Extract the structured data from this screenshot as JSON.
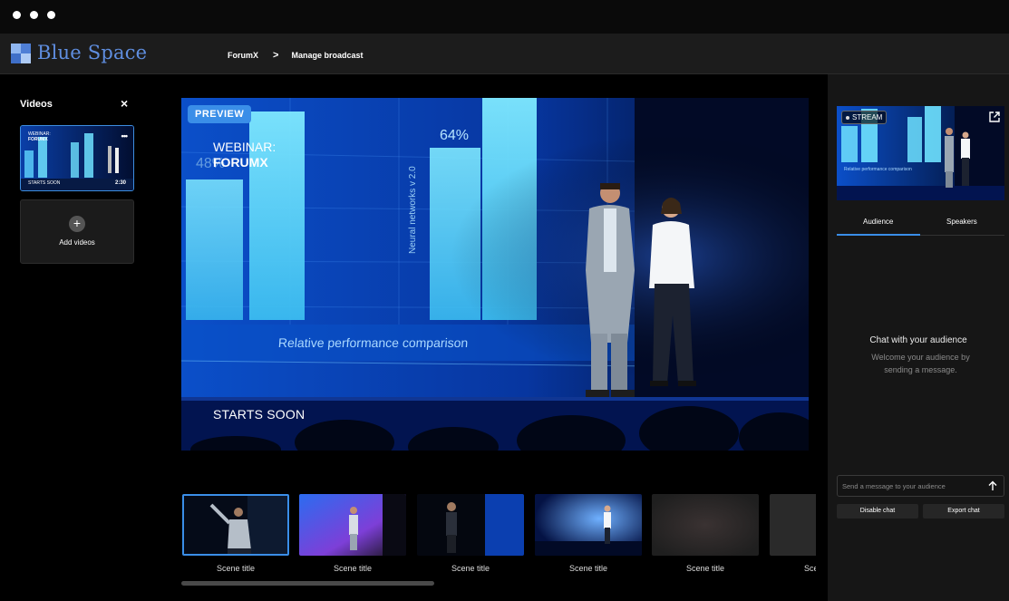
{
  "window": {
    "controls": [
      "dot",
      "dot",
      "dot"
    ]
  },
  "header": {
    "brand": "Blue Space",
    "breadcrumb": [
      "ForumX",
      "Manage broadcast"
    ],
    "breadcrumb_separator": ">"
  },
  "sidebar": {
    "title": "Videos",
    "close_label": "×",
    "video": {
      "title_line1": "WEBINAR:",
      "title_line2": "FORUMX",
      "status": "STARTS SOON",
      "duration": "2:30",
      "more_label": "•••"
    },
    "add_label": "Add videos",
    "add_icon": "+"
  },
  "preview": {
    "badge": "PREVIEW",
    "webinar_line1": "WEBINAR:",
    "webinar_line2": "FORUMX",
    "status": "STARTS SOON",
    "screen_caption": "Relative performance comparison",
    "screen_pct_main": "64%",
    "screen_pct_left": "48%",
    "screen_vertical": "Neural networks v 2.0"
  },
  "stream": {
    "badge": "STREAM",
    "caption": "Relative performance comparison"
  },
  "chat": {
    "tabs": [
      "Audience",
      "Speakers"
    ],
    "active_tab": 0,
    "empty_title": "Chat with your audience",
    "empty_subtitle": "Welcome your audience by sending a message.",
    "input_placeholder": "Send a message to your audience",
    "disable_label": "Disable chat",
    "export_label": "Export chat"
  },
  "scenes": [
    {
      "label": "Scene title",
      "active": true
    },
    {
      "label": "Scene title",
      "active": false
    },
    {
      "label": "Scene title",
      "active": false
    },
    {
      "label": "Scene title",
      "active": false
    },
    {
      "label": "Scene title",
      "active": false
    },
    {
      "label": "Sce",
      "active": false
    }
  ],
  "colors": {
    "accent": "#3a8ee8",
    "brand": "#5f8ee0",
    "panel": "#161616",
    "header": "#1c1c1c"
  }
}
